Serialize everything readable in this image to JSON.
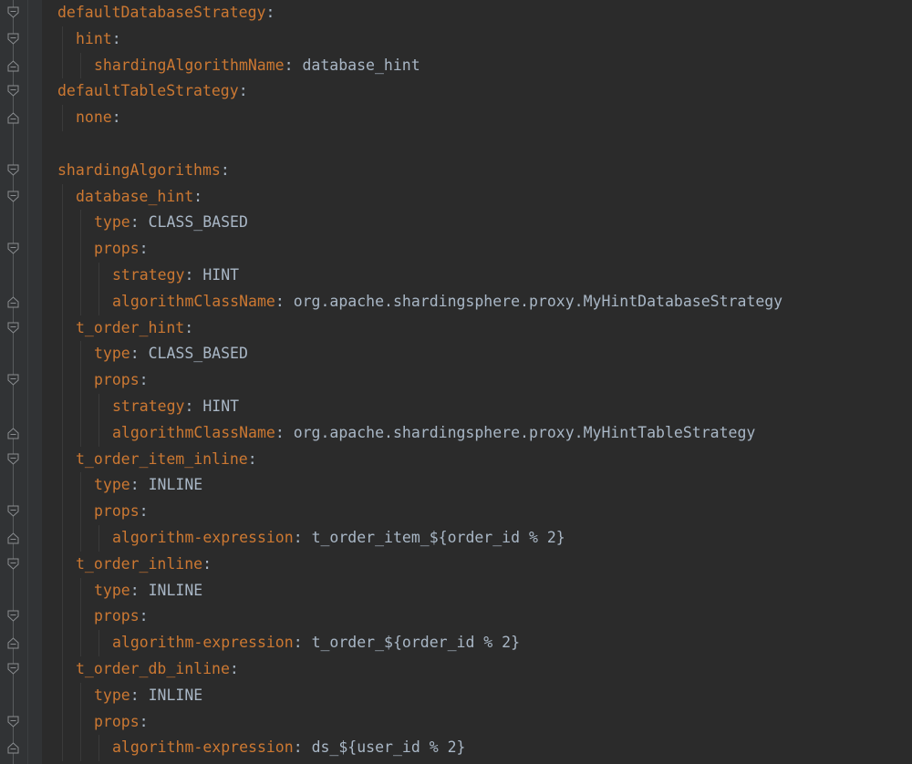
{
  "editor": {
    "language": "yaml",
    "colors": {
      "background": "#2b2b2b",
      "gutter": "#313335",
      "key": "#cc7832",
      "value": "#a9b7c6"
    },
    "lines": [
      {
        "indent": 0,
        "key": "defaultDatabaseStrategy",
        "value": "",
        "fold": "open"
      },
      {
        "indent": 1,
        "key": "hint",
        "value": "",
        "fold": "open"
      },
      {
        "indent": 2,
        "key": "shardingAlgorithmName",
        "value": "database_hint",
        "fold": "close"
      },
      {
        "indent": 0,
        "key": "defaultTableStrategy",
        "value": "",
        "fold": "open"
      },
      {
        "indent": 1,
        "key": "none",
        "value": "",
        "fold": "close"
      },
      {
        "indent": 0,
        "key": "",
        "value": "",
        "fold": ""
      },
      {
        "indent": 0,
        "key": "shardingAlgorithms",
        "value": "",
        "fold": "open"
      },
      {
        "indent": 1,
        "key": "database_hint",
        "value": "",
        "fold": "open"
      },
      {
        "indent": 2,
        "key": "type",
        "value": "CLASS_BASED",
        "fold": ""
      },
      {
        "indent": 2,
        "key": "props",
        "value": "",
        "fold": "open"
      },
      {
        "indent": 3,
        "key": "strategy",
        "value": "HINT",
        "fold": ""
      },
      {
        "indent": 3,
        "key": "algorithmClassName",
        "value": "org.apache.shardingsphere.proxy.MyHintDatabaseStrategy",
        "fold": "close"
      },
      {
        "indent": 1,
        "key": "t_order_hint",
        "value": "",
        "fold": "open"
      },
      {
        "indent": 2,
        "key": "type",
        "value": "CLASS_BASED",
        "fold": ""
      },
      {
        "indent": 2,
        "key": "props",
        "value": "",
        "fold": "open"
      },
      {
        "indent": 3,
        "key": "strategy",
        "value": "HINT",
        "fold": ""
      },
      {
        "indent": 3,
        "key": "algorithmClassName",
        "value": "org.apache.shardingsphere.proxy.MyHintTableStrategy",
        "fold": "close"
      },
      {
        "indent": 1,
        "key": "t_order_item_inline",
        "value": "",
        "fold": "open"
      },
      {
        "indent": 2,
        "key": "type",
        "value": "INLINE",
        "fold": ""
      },
      {
        "indent": 2,
        "key": "props",
        "value": "",
        "fold": "open"
      },
      {
        "indent": 3,
        "key": "algorithm-expression",
        "value": "t_order_item_${order_id % 2}",
        "fold": "close"
      },
      {
        "indent": 1,
        "key": "t_order_inline",
        "value": "",
        "fold": "open"
      },
      {
        "indent": 2,
        "key": "type",
        "value": "INLINE",
        "fold": ""
      },
      {
        "indent": 2,
        "key": "props",
        "value": "",
        "fold": "open"
      },
      {
        "indent": 3,
        "key": "algorithm-expression",
        "value": "t_order_${order_id % 2}",
        "fold": "close"
      },
      {
        "indent": 1,
        "key": "t_order_db_inline",
        "value": "",
        "fold": "open"
      },
      {
        "indent": 2,
        "key": "type",
        "value": "INLINE",
        "fold": ""
      },
      {
        "indent": 2,
        "key": "props",
        "value": "",
        "fold": "open"
      },
      {
        "indent": 3,
        "key": "algorithm-expression",
        "value": "ds_${user_id % 2}",
        "fold": "close"
      }
    ]
  }
}
